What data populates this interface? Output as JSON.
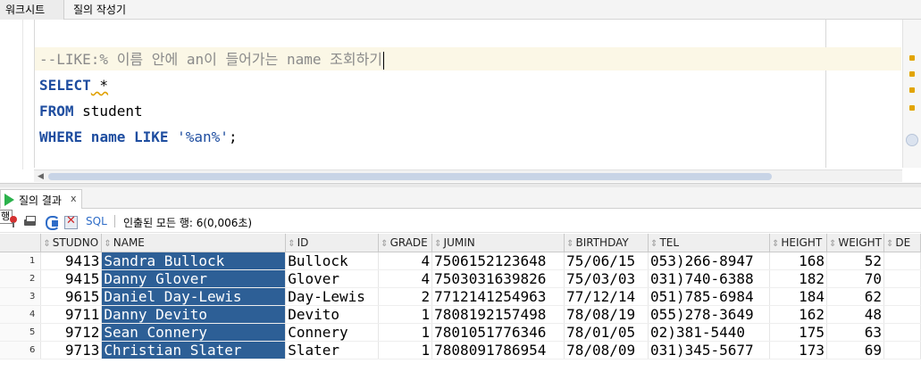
{
  "top_tabs": [
    "워크시트",
    "질의 작성기"
  ],
  "editor": {
    "lines": [
      {
        "comment": "--LIKE:% 이름 안에 an이 들어가는 name 조회하기"
      },
      {
        "kw1": "SELECT",
        "rest": " *"
      },
      {
        "kw1": "FROM",
        "rest": " student"
      },
      {
        "kw1": "WHERE",
        "mid": " name ",
        "kw2": "LIKE",
        "str": " '%an%'",
        "end": ";"
      }
    ]
  },
  "result_tab": {
    "label": "질의 결과",
    "close": "x"
  },
  "toolbar": {
    "tooltip_glyph": "행",
    "sql_label": "SQL",
    "separator": "|",
    "status": "인출된 모든 행: 6(0,006초)"
  },
  "grid": {
    "columns": [
      "STUDNO",
      "NAME",
      "ID",
      "GRADE",
      "JUMIN",
      "BIRTHDAY",
      "TEL",
      "HEIGHT",
      "WEIGHT",
      "DE"
    ],
    "rows": [
      {
        "rn": "1",
        "studno": "9413",
        "name": "Sandra Bullock",
        "id": "Bullock",
        "grade": "4",
        "jumin": "7506152123648",
        "birthday": "75/06/15",
        "tel": "053)266-8947",
        "height": "168",
        "weight": "52"
      },
      {
        "rn": "2",
        "studno": "9415",
        "name": "Danny Glover",
        "id": "Glover",
        "grade": "4",
        "jumin": "7503031639826",
        "birthday": "75/03/03",
        "tel": "031)740-6388",
        "height": "182",
        "weight": "70"
      },
      {
        "rn": "3",
        "studno": "9615",
        "name": "Daniel Day-Lewis",
        "id": "Day-Lewis",
        "grade": "2",
        "jumin": "7712141254963",
        "birthday": "77/12/14",
        "tel": "051)785-6984",
        "height": "184",
        "weight": "62"
      },
      {
        "rn": "4",
        "studno": "9711",
        "name": "Danny Devito",
        "id": "Devito",
        "grade": "1",
        "jumin": "7808192157498",
        "birthday": "78/08/19",
        "tel": "055)278-3649",
        "height": "162",
        "weight": "48"
      },
      {
        "rn": "5",
        "studno": "9712",
        "name": "Sean Connery",
        "id": "Connery",
        "grade": "1",
        "jumin": "7801051776346",
        "birthday": "78/01/05",
        "tel": "02)381-5440",
        "height": "175",
        "weight": "63"
      },
      {
        "rn": "6",
        "studno": "9713",
        "name": "Christian Slater",
        "id": "Slater",
        "grade": "1",
        "jumin": "7808091786954",
        "birthday": "78/08/09",
        "tel": "031)345-5677",
        "height": "173",
        "weight": "69"
      }
    ]
  },
  "colors": {
    "selection": "#2d5f96",
    "keyword": "#1f4ea0",
    "current_line": "#fbf7e6"
  }
}
